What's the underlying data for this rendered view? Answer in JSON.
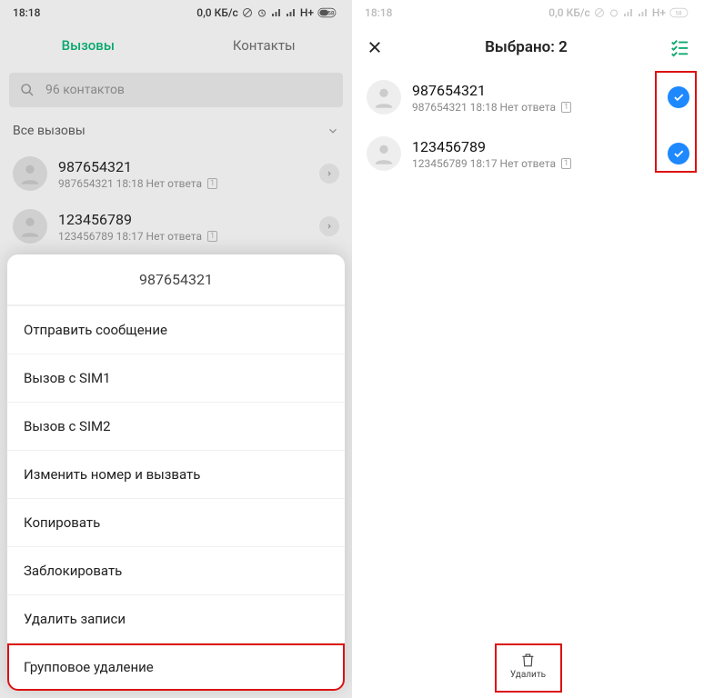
{
  "status": {
    "time": "18:18",
    "right": "0,0 КБ/с",
    "net": "H+",
    "batt": "58"
  },
  "left": {
    "tabs": {
      "calls": "Вызовы",
      "contacts": "Контакты"
    },
    "search_placeholder": "96 контактов",
    "filter": "Все вызовы",
    "calls": [
      {
        "number": "987654321",
        "meta": "987654321  18:18 Нет ответа"
      },
      {
        "number": "123456789",
        "meta": "123456789  18:17 Нет ответа"
      }
    ],
    "sheet": {
      "title": "987654321",
      "items": [
        "Отправить сообщение",
        "Вызов с SIM1",
        "Вызов с SIM2",
        "Изменить номер и вызвать",
        "Копировать",
        "Заблокировать",
        "Удалить записи",
        "Групповое удаление"
      ]
    }
  },
  "right": {
    "header_title": "Выбрано: 2",
    "items": [
      {
        "number": "987654321",
        "meta": "987654321  18:18 Нет ответа"
      },
      {
        "number": "123456789",
        "meta": "123456789  18:17 Нет ответа"
      }
    ],
    "delete_label": "Удалить"
  }
}
